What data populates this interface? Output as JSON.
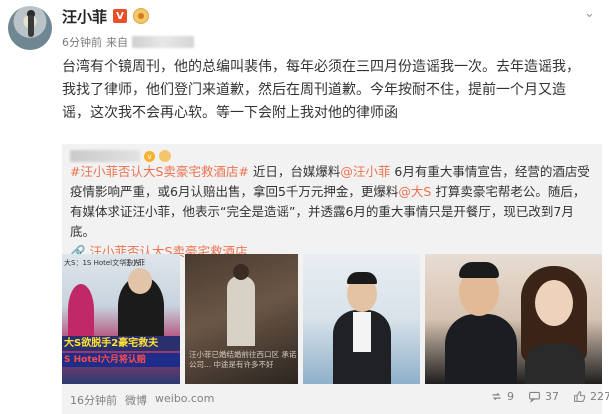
{
  "author": {
    "name": "汪小菲",
    "time": "6分钟前",
    "source_prefix": "来自"
  },
  "post_text": "台湾有个镜周刊，他的总编叫裴伟，每年必须在三四月份造谣我一次。去年造谣我，我找了律师，他们登门来道歉，然后在周刊道歉。今年按耐不住，提前一个月又造谣，这次我不会再心软。等一下会附上我对他的律师函",
  "quote": {
    "hashtag": "#汪小菲否认大S卖豪宅救酒店#",
    "text_1": " 近日，台媒爆料",
    "mention_1": "@汪小菲",
    "text_2": " 6月有重大事情宣告，经营的酒店受疫情影响严重，或6月认赔出售，拿回5千万元押金，更爆料",
    "mention_2": "@大S",
    "text_3": " 打算卖豪宅帮老公。随后，有媒体求证汪小菲，他表示“完全是造谣”，并透露6月的重大事情只是开餐厅，现已改到7月底。",
    "topic_link": "汪小菲否认大S卖豪宅救酒店",
    "images": {
      "pic1_caption_left": "大S：1S Hotel文华东方",
      "pic1_caption_right": "汪小菲",
      "pic1_band_1": "大S欲脱手2豪宅救夫",
      "pic1_band_2": "S Hotel六月将认赔",
      "pic2_text": "汪小菲已婚结婚前往西口区 承诺公司... 中途是有许多不好"
    },
    "footer_time": "16分钟前",
    "footer_platform": "微博",
    "footer_site": "weibo.com"
  },
  "actions": {
    "repost_count": "9",
    "comment_count": "37",
    "like_count": "227"
  },
  "colors": {
    "link": "#eb7350",
    "badge_v": "#e8502a",
    "quote_bg": "#f2f2f2"
  }
}
